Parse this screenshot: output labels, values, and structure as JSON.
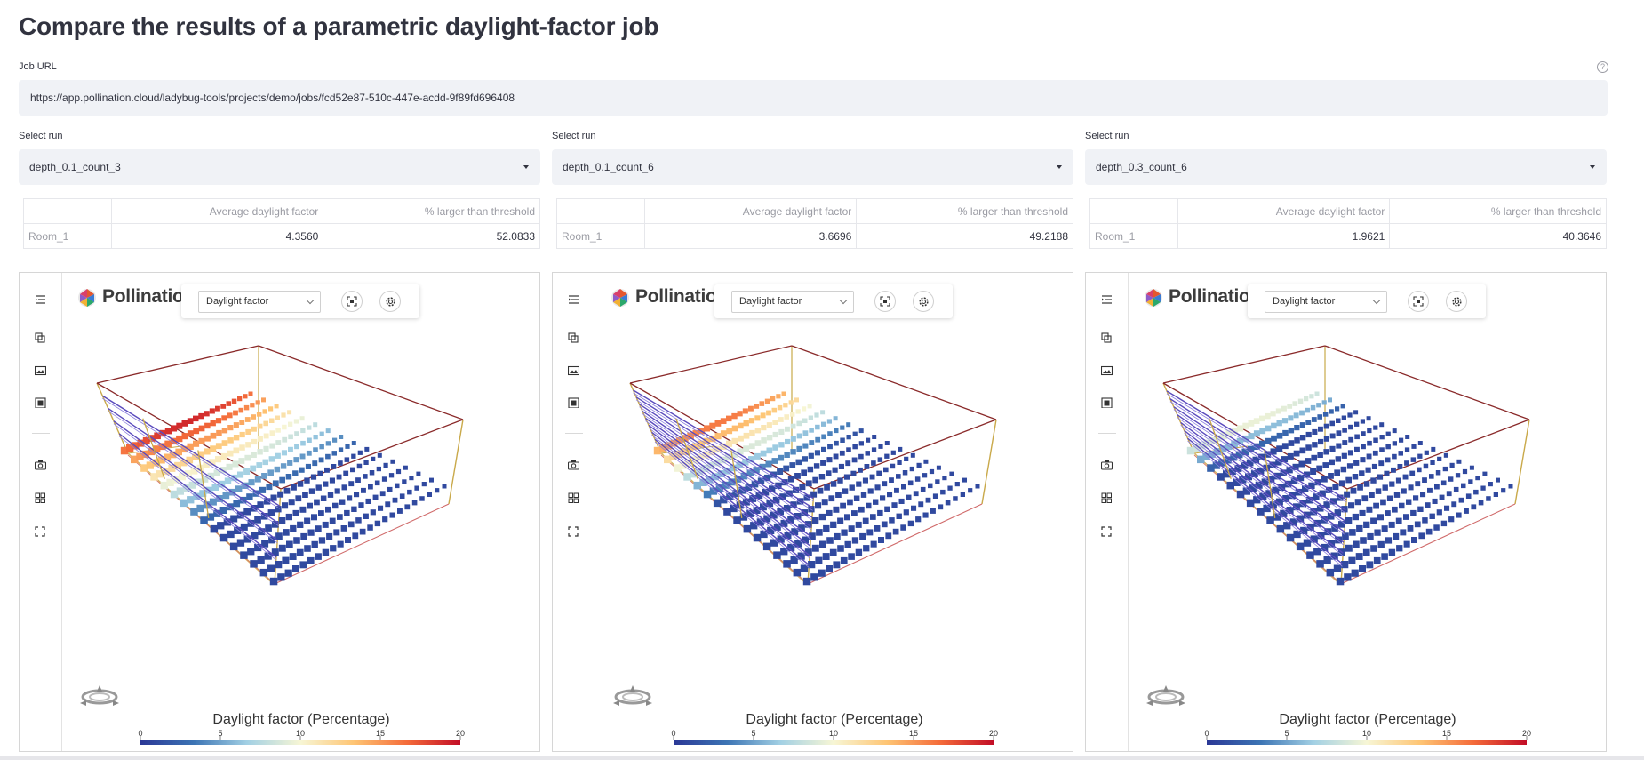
{
  "page": {
    "title": "Compare the results of a parametric daylight-factor job",
    "job_url_label": "Job URL",
    "job_url_value": "https://app.pollination.cloud/ladybug-tools/projects/demo/jobs/fcd52e87-510c-447e-acdd-9f89fd696408",
    "help_glyph": "?"
  },
  "columns": [
    {
      "select_label": "Select run",
      "select_value": "depth_0.1_count_3",
      "table": {
        "headers": [
          "",
          "Average daylight factor",
          "% larger than threshold"
        ],
        "rows": [
          [
            "Room_1",
            "4.3560",
            "52.0833"
          ]
        ]
      },
      "viewer": {
        "logo_text": "Pollination",
        "display_select": "Daylight factor",
        "legend_title": "Daylight factor (Percentage)",
        "legend_ticks": [
          "0",
          "5",
          "10",
          "15",
          "20"
        ]
      }
    },
    {
      "select_label": "Select run",
      "select_value": "depth_0.1_count_6",
      "table": {
        "headers": [
          "",
          "Average daylight factor",
          "% larger than threshold"
        ],
        "rows": [
          [
            "Room_1",
            "3.6696",
            "49.2188"
          ]
        ]
      },
      "viewer": {
        "logo_text": "Pollination",
        "display_select": "Daylight factor",
        "legend_title": "Daylight factor (Percentage)",
        "legend_ticks": [
          "0",
          "5",
          "10",
          "15",
          "20"
        ]
      }
    },
    {
      "select_label": "Select run",
      "select_value": "depth_0.3_count_6",
      "table": {
        "headers": [
          "",
          "Average daylight factor",
          "% larger than threshold"
        ],
        "rows": [
          [
            "Room_1",
            "1.9621",
            "40.3646"
          ]
        ]
      },
      "viewer": {
        "logo_text": "Pollination",
        "display_select": "Daylight factor",
        "legend_title": "Daylight factor (Percentage)",
        "legend_ticks": [
          "0",
          "5",
          "10",
          "15",
          "20"
        ]
      }
    }
  ],
  "rail_icons": [
    "outline-icon",
    "layers-icon",
    "image-icon",
    "grid-map-icon",
    "camera-icon",
    "views-icon",
    "fullscreen-icon"
  ],
  "toolbar_icons": [
    "fit-view-icon",
    "settings-gear-icon"
  ],
  "colors": {
    "legend_gradient": [
      "#2b3896",
      "#3c74b4",
      "#a2d0e4",
      "#f7f6d5",
      "#fec574",
      "#f46b3a",
      "#c20d26"
    ],
    "input_bg": "#f0f2f6",
    "room_edge": "#c9a94a",
    "room_top": "#8a2a2a",
    "shade": "#5b4bbd"
  }
}
